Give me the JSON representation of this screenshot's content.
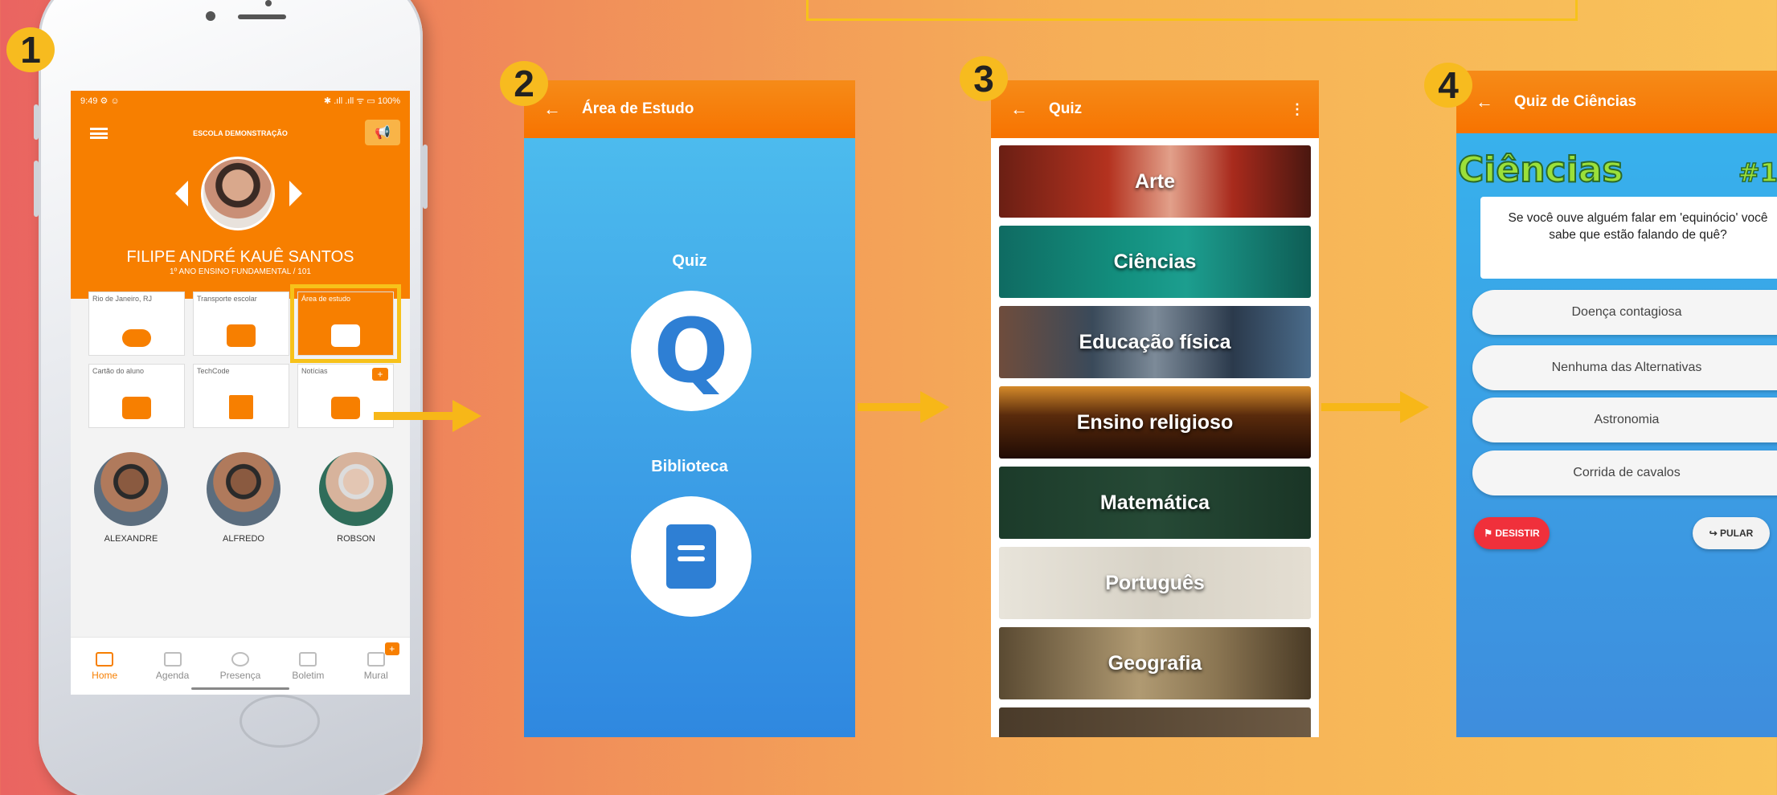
{
  "steps": [
    "1",
    "2",
    "3",
    "4"
  ],
  "phone": {
    "status_time": "9:49 ⚙ ☺",
    "status_right": "✱ .ıll .ıll ᯤ ▭ 100%",
    "school": "ESCOLA DEMONSTRAÇÃO",
    "student_name": "FILIPE ANDRÉ KAUÊ SANTOS",
    "student_class": "1º ANO ENSINO FUNDAMENTAL / 101",
    "tiles": [
      {
        "label": "Rio de Janeiro, RJ",
        "icon": "cloud-icon"
      },
      {
        "label": "Transporte escolar",
        "icon": "bus-icon"
      },
      {
        "label": "Área de estudo",
        "icon": "study-icon"
      },
      {
        "label": "Cartão do aluno",
        "icon": "id-card-icon"
      },
      {
        "label": "TechCode",
        "icon": "qr-code-icon"
      },
      {
        "label": "Notícias",
        "icon": "news-icon",
        "badge": "+"
      }
    ],
    "teachers": [
      "ALEXANDRE",
      "ALFREDO",
      "ROBSON"
    ],
    "nav": [
      {
        "label": "Home",
        "icon": "home-icon"
      },
      {
        "label": "Agenda",
        "icon": "calendar-icon"
      },
      {
        "label": "Presença",
        "icon": "location-icon"
      },
      {
        "label": "Boletim",
        "icon": "list-icon"
      },
      {
        "label": "Mural",
        "icon": "mural-icon",
        "badge": "+"
      }
    ]
  },
  "screen2": {
    "back": "←",
    "title": "Área de Estudo",
    "quiz_label": "Quiz",
    "quiz_glyph": "Q",
    "library_label": "Biblioteca"
  },
  "screen3": {
    "back": "←",
    "title": "Quiz",
    "menu": "⋮",
    "categories": [
      "Arte",
      "Ciências",
      "Educação física",
      "Ensino religioso",
      "Matemática",
      "Português",
      "Geografia"
    ]
  },
  "screen4": {
    "back": "←",
    "title": "Quiz de Ciências",
    "subject": "Ciências",
    "number": "#1",
    "question": "Se você ouve alguém falar em 'equinócio' você sabe que estão falando de quê?",
    "answers": [
      "Doença contagiosa",
      "Nenhuma das Alternativas",
      "Astronomia",
      "Corrida de cavalos"
    ],
    "give_up": "⚑ DESISTIR",
    "skip": "↪ PULAR"
  },
  "colors": {
    "accent": "#f77f00",
    "badge": "#f7bb1f",
    "answer_subject": "#9be03a",
    "danger": "#f0303b"
  }
}
